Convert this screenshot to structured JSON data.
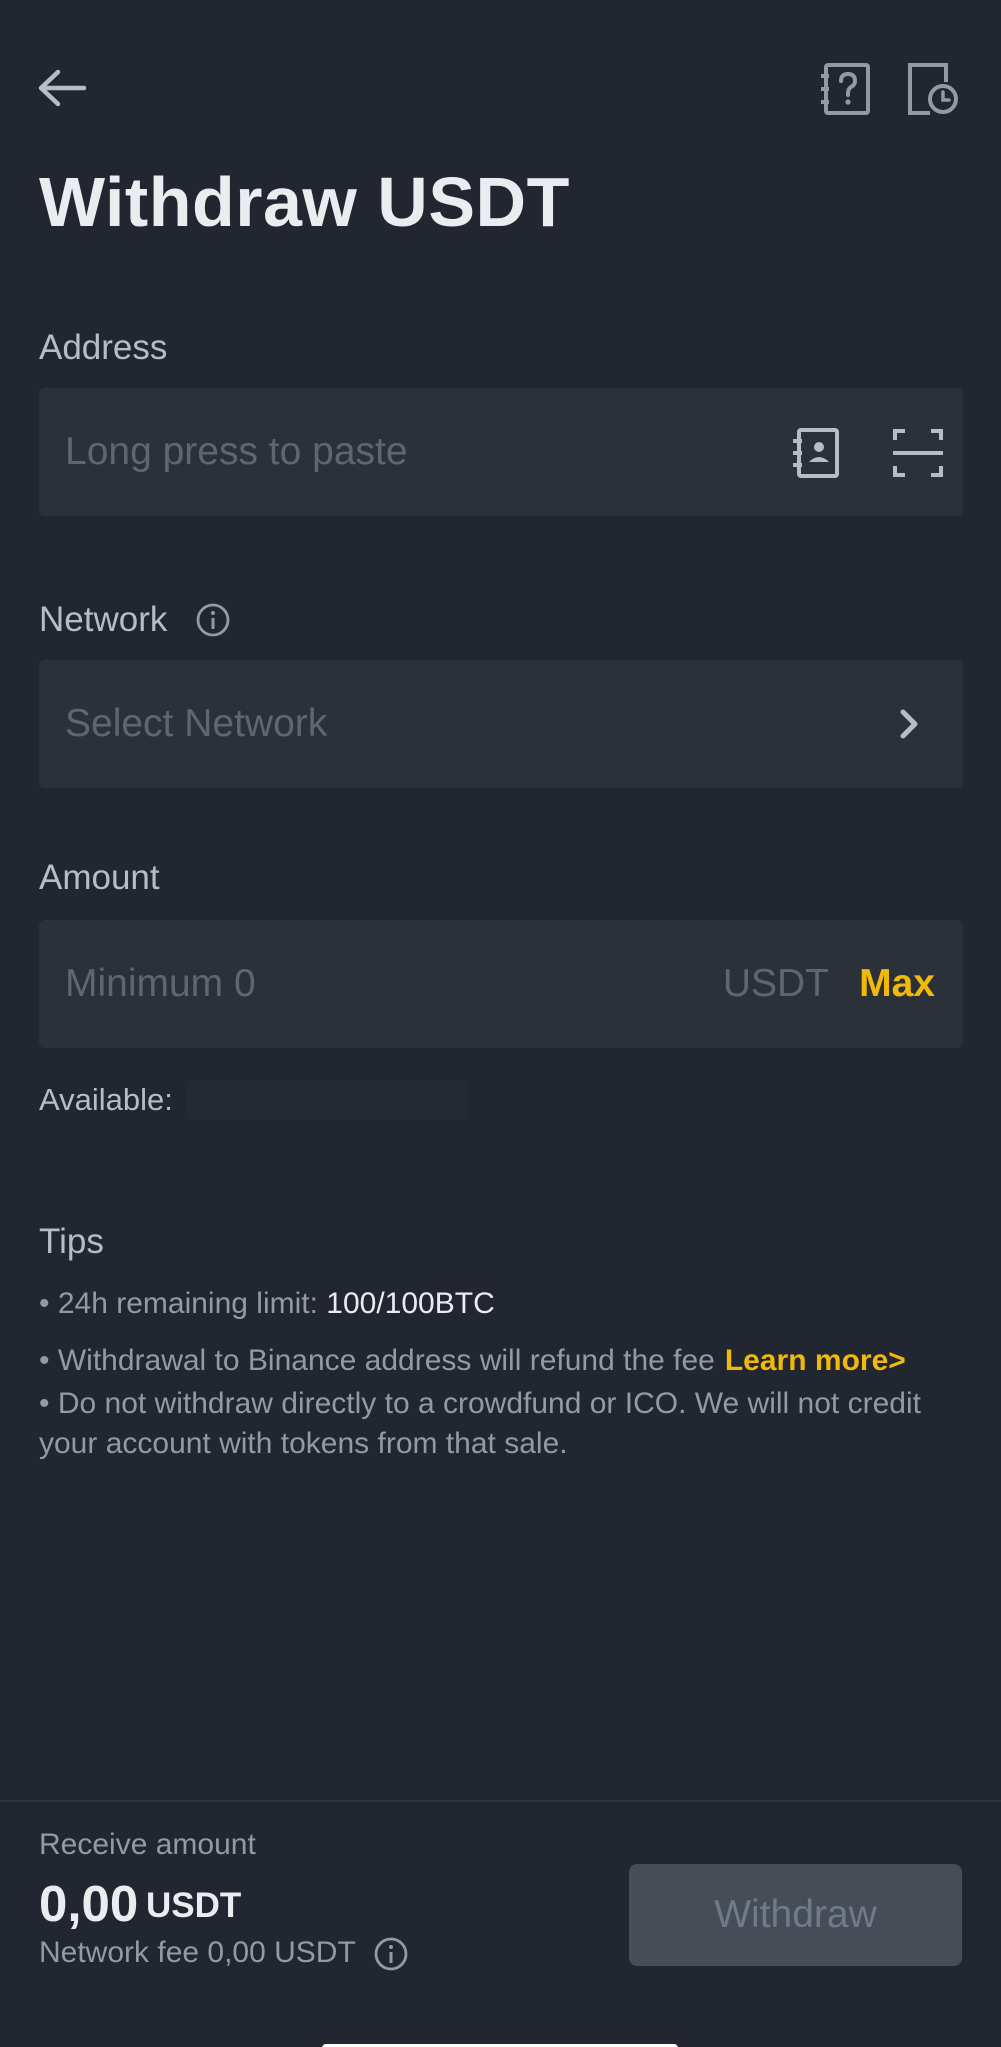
{
  "header": {
    "title": "Withdraw USDT",
    "back_icon": "arrow-left-icon",
    "help_icon": "question-book-icon",
    "history_icon": "document-clock-icon"
  },
  "address": {
    "label": "Address",
    "placeholder": "Long press to paste",
    "address_book_icon": "address-book-icon",
    "scan_icon": "scan-icon"
  },
  "network": {
    "label": "Network",
    "placeholder": "Select Network",
    "info_icon": "info-icon",
    "chevron_icon": "chevron-right-icon"
  },
  "amount": {
    "label": "Amount",
    "placeholder": "Minimum 0",
    "unit": "USDT",
    "max_label": "Max",
    "available_label": "Available:"
  },
  "tips": {
    "title": "Tips",
    "limit_prefix": "• 24h remaining limit: ",
    "limit_value": "100/100BTC",
    "refund_text": "• Withdrawal to Binance address will refund the fee",
    "learn_more": "Learn more>",
    "ico_text": "• Do not withdraw directly to a crowdfund or ICO. We will not credit your account with tokens from that sale."
  },
  "footer": {
    "receive_label": "Receive amount",
    "receive_amount": "0,00",
    "receive_unit": "USDT",
    "network_fee": "Network fee 0,00 USDT",
    "withdraw_label": "Withdraw"
  },
  "colors": {
    "background": "#222630",
    "field": "#2b3139",
    "accent": "#f0b90b",
    "button_disabled": "#474d57"
  }
}
